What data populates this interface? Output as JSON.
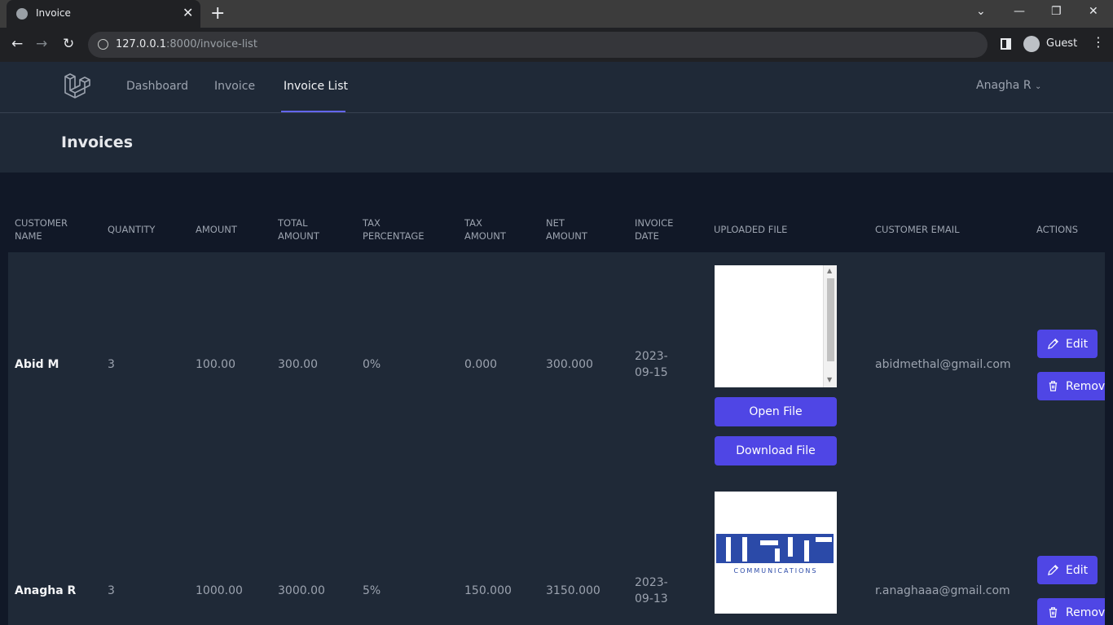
{
  "browser": {
    "tab_title": "Invoice",
    "url_host": "127.0.0.1",
    "url_path": ":8000/invoice-list",
    "profile": "Guest"
  },
  "nav": {
    "links": [
      "Dashboard",
      "Invoice",
      "Invoice List"
    ],
    "active": "Invoice List",
    "user": "Anagha R"
  },
  "page": {
    "title": "Invoices"
  },
  "table": {
    "headers": {
      "customer_name": [
        "CUSTOMER",
        "NAME"
      ],
      "quantity": "QUANTITY",
      "amount": "AMOUNT",
      "total_amount": [
        "TOTAL",
        "AMOUNT"
      ],
      "tax_percentage": [
        "TAX",
        "PERCENTAGE"
      ],
      "tax_amount": [
        "TAX",
        "AMOUNT"
      ],
      "net_amount": [
        "NET",
        "AMOUNT"
      ],
      "invoice_date": [
        "INVOICE",
        "DATE"
      ],
      "uploaded_file": "UPLOADED FILE",
      "customer_email": "CUSTOMER EMAIL",
      "actions": "ACTIONS"
    },
    "rows": [
      {
        "name": "Abid M",
        "quantity": "3",
        "amount": "100.00",
        "total": "300.00",
        "tax_pct": "0%",
        "tax_amt": "0.000",
        "net": "300.000",
        "date1": "2023-",
        "date2": "09-15",
        "email": "abidmethal@gmail.com",
        "open_file": "Open File",
        "download_file": "Download File",
        "edit": "Edit",
        "remove": "Remove"
      },
      {
        "name": "Anagha R",
        "quantity": "3",
        "amount": "1000.00",
        "total": "3000.00",
        "tax_pct": "5%",
        "tax_amt": "150.000",
        "net": "3150.000",
        "date1": "2023-",
        "date2": "09-13",
        "email": "r.anaghaaa@gmail.com",
        "file_logo": "msi",
        "file_logo_sub": "COMMUNICATIONS",
        "edit": "Edit",
        "remove": "Remove"
      }
    ]
  },
  "colors": {
    "accent": "#4f46e5",
    "bg": "#111827",
    "panel": "#1f2937"
  }
}
